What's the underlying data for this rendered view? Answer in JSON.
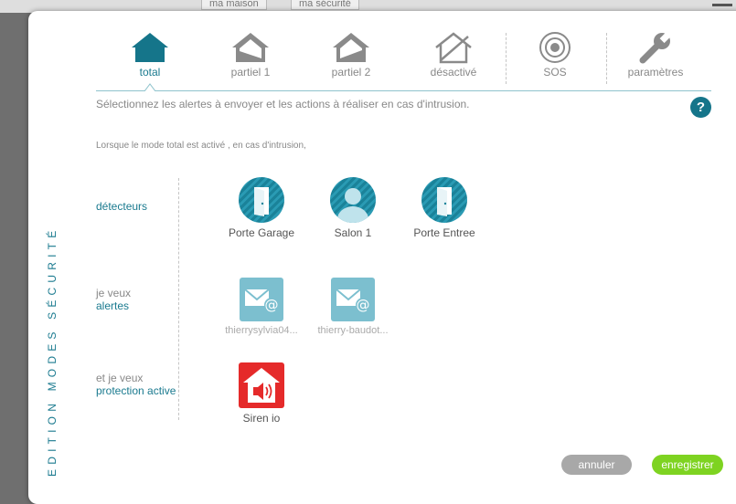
{
  "background": {
    "tabs": [
      "ma maison",
      "ma sécurité"
    ]
  },
  "modal": {
    "side_title": "EDITION MODES SÉCURITÉ",
    "mode_tabs": [
      {
        "label": "total",
        "icon": "house-filled-icon",
        "active": true
      },
      {
        "label": "partiel 1",
        "icon": "house-partial-icon",
        "active": false
      },
      {
        "label": "partiel 2",
        "icon": "house-partial-icon",
        "active": false
      },
      {
        "label": "désactivé",
        "icon": "house-disabled-icon",
        "active": false
      },
      {
        "label": "SOS",
        "icon": "sos-target-icon",
        "active": false
      },
      {
        "label": "paramètres",
        "icon": "wrench-icon",
        "active": false
      }
    ],
    "hint": "Sélectionnez les alertes à envoyer et les actions à réaliser en cas d'intrusion.",
    "help_label": "?",
    "intro": "Lorsque le mode total est activé , en cas d'intrusion,",
    "rows": {
      "detectors": {
        "label": "détecteurs",
        "items": [
          {
            "name": "Porte Garage",
            "icon": "door-sensor-icon"
          },
          {
            "name": "Salon 1",
            "icon": "motion-sensor-icon"
          },
          {
            "name": "Porte Entree",
            "icon": "door-sensor-icon"
          }
        ]
      },
      "alerts": {
        "label_gray": "je veux",
        "label_blue": "alertes",
        "items": [
          {
            "name": "thierrysylvia04...",
            "icon": "email-icon"
          },
          {
            "name": "thierry-baudot...",
            "icon": "email-icon"
          }
        ]
      },
      "protection": {
        "label_gray": "et je veux",
        "label_blue": "protection active",
        "items": [
          {
            "name": "Siren io",
            "icon": "siren-icon"
          }
        ]
      }
    },
    "buttons": {
      "cancel": "annuler",
      "save": "enregistrer"
    }
  }
}
